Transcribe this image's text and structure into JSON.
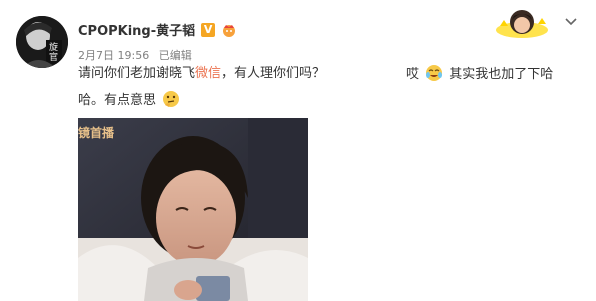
{
  "post": {
    "username": "CPOPKing-黄子韬",
    "verified_badge": "V",
    "date": "2月7日 19:56",
    "edited": "已编辑",
    "text_line1_a": "请问你们老加谢晓飞",
    "text_line1_link": "微信",
    "text_line1_b": "，有人理你们吗？",
    "text_line1_c": "哎",
    "text_line1_d": "其实我也加了下哈",
    "text_line2": "哈。有点意思",
    "image_watermark": "镜首播"
  },
  "colors": {
    "link": "#eb7350",
    "badge": "#f5a623",
    "meta": "#808080"
  },
  "icons": [
    "verified-icon",
    "crown-icon",
    "chevron-down-icon",
    "laugh-cry-emoji-icon",
    "thinking-emoji-icon"
  ]
}
